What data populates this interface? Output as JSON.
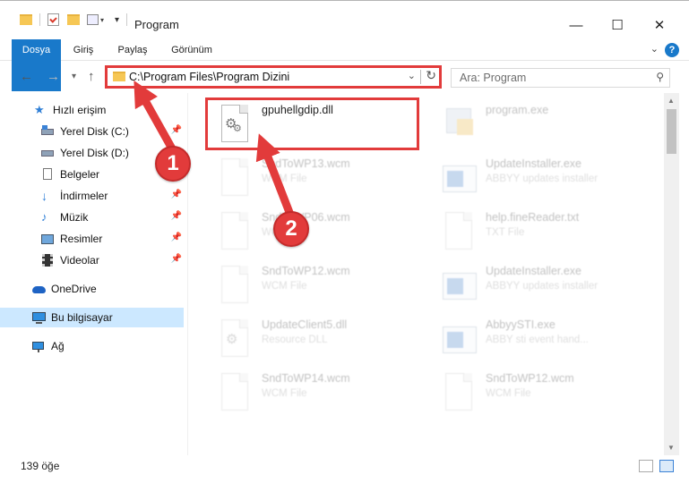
{
  "window": {
    "title": "Program",
    "minimize": "—",
    "maximize": "☐",
    "close": "✕"
  },
  "ribbon": {
    "tabs": [
      "Dosya",
      "Giriş",
      "Paylaş",
      "Görünüm"
    ],
    "help": "?"
  },
  "nav": {
    "address": "C:\\Program Files\\Program Dizini",
    "search_placeholder": "Ara: Program"
  },
  "sidebar": {
    "items": [
      {
        "label": "Hızlı erişim",
        "icon": "star-icon"
      },
      {
        "label": "Yerel Disk (C:)",
        "icon": "drive-icon"
      },
      {
        "label": "Yerel Disk (D:)",
        "icon": "drive-icon"
      },
      {
        "label": "Belgeler",
        "icon": "documents-icon"
      },
      {
        "label": "İndirmeler",
        "icon": "downloads-icon"
      },
      {
        "label": "Müzik",
        "icon": "music-icon"
      },
      {
        "label": "Resimler",
        "icon": "pictures-icon"
      },
      {
        "label": "Videolar",
        "icon": "videos-icon"
      },
      {
        "label": "OneDrive",
        "icon": "cloud-icon"
      },
      {
        "label": "Bu bilgisayar",
        "icon": "computer-icon"
      },
      {
        "label": "Ağ",
        "icon": "network-icon"
      }
    ]
  },
  "files": [
    {
      "name": "gpuhellgdip.dll",
      "type": ""
    },
    {
      "name": "program.exe",
      "type": ""
    },
    {
      "name": "SndToWP13.wcm",
      "type": "WCM File"
    },
    {
      "name": "UpdateInstaller.exe",
      "type": "ABBYY updates installer"
    },
    {
      "name": "SndToWP06.wcm",
      "type": "WCM File"
    },
    {
      "name": "help.fineReader.txt",
      "type": "TXT File"
    },
    {
      "name": "SndToWP12.wcm",
      "type": "WCM File"
    },
    {
      "name": "UpdateInstaller.exe",
      "type": "ABBYY updates installer"
    },
    {
      "name": "UpdateClient5.dll",
      "type": "Resource DLL"
    },
    {
      "name": "AbbyySTI.exe",
      "type": "ABBY sti event hand..."
    },
    {
      "name": "SndToWP14.wcm",
      "type": "WCM File"
    },
    {
      "name": "SndToWP12.wcm",
      "type": "WCM File"
    }
  ],
  "status": {
    "count": "139 öğe"
  },
  "annotations": {
    "step1": "1",
    "step2": "2",
    "color": "#e23b3b"
  }
}
